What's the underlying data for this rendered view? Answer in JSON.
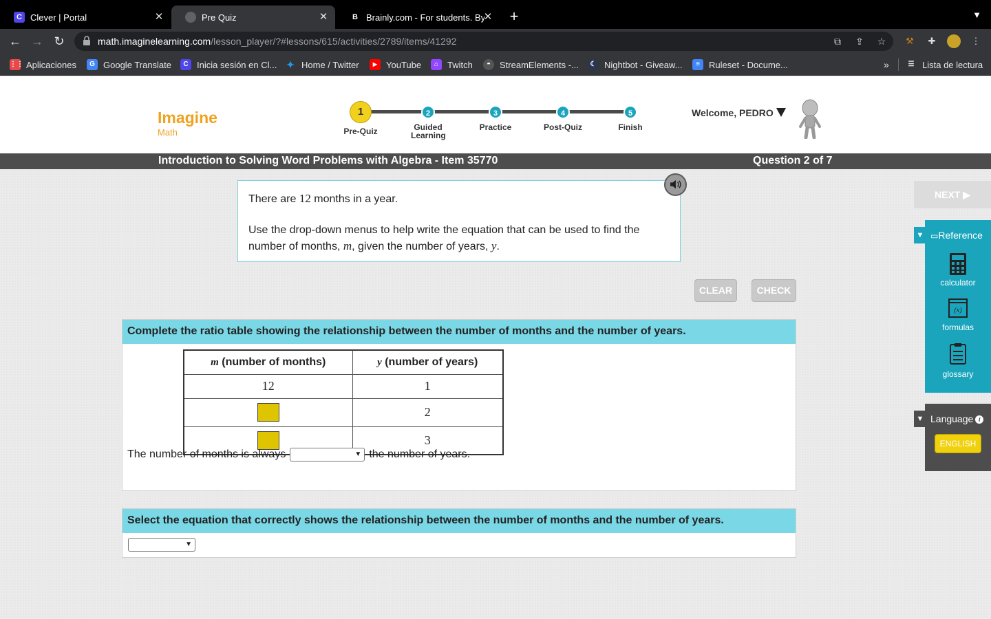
{
  "browser": {
    "tabs": [
      {
        "title": "Clever | Portal",
        "icon": "clever-icon",
        "color": "#4f45ea"
      },
      {
        "title": "Pre Quiz",
        "icon": "globe-icon",
        "active": true
      },
      {
        "title": "Brainly.com - For students. By",
        "icon": "brainly-icon"
      }
    ],
    "url_host": "math.imaginelearning.com",
    "url_path": "/lesson_player/?#lessons/615/activities/2789/items/41292",
    "bookmarks": [
      {
        "label": "Aplicaciones",
        "icon": "apps-grid-icon"
      },
      {
        "label": "Google Translate",
        "icon": "google-translate-icon"
      },
      {
        "label": "Inicia sesión en Cl...",
        "icon": "clever-icon"
      },
      {
        "label": "Home / Twitter",
        "icon": "twitter-icon"
      },
      {
        "label": "YouTube",
        "icon": "youtube-icon"
      },
      {
        "label": "Twitch",
        "icon": "twitch-icon"
      },
      {
        "label": "StreamElements -...",
        "icon": "streamelements-icon"
      },
      {
        "label": "Nightbot - Giveaw...",
        "icon": "nightbot-icon"
      },
      {
        "label": "Ruleset - Docume...",
        "icon": "google-docs-icon"
      }
    ],
    "reading_list": "Lista de lectura"
  },
  "app": {
    "logo_top": "Imagine",
    "logo_bottom": "Math",
    "steps": [
      {
        "num": "1",
        "label": "Pre-Quiz",
        "active": true
      },
      {
        "num": "2",
        "label": "Guided Learning"
      },
      {
        "num": "3",
        "label": "Practice"
      },
      {
        "num": "4",
        "label": "Post-Quiz"
      },
      {
        "num": "5",
        "label": "Finish"
      }
    ],
    "welcome": "Welcome, PEDRO",
    "lesson_title": "Introduction to Solving Word Problems with Algebra - Item 35770",
    "question_count": "Question 2 of 7"
  },
  "prompt": {
    "line1_pre": "There are ",
    "line1_num": "12",
    "line1_post": " months in a year.",
    "line2_a": "Use the drop-down menus to help write the equation that can be used to find the number of months, ",
    "var_m": "m",
    "line2_b": ", given the number of years, ",
    "var_y": "y",
    "line2_c": "."
  },
  "buttons": {
    "clear": "CLEAR",
    "check": "CHECK",
    "next": "NEXT ▶"
  },
  "part1": {
    "heading": "Complete the ratio table showing the relationship between the number of months and the number of years.",
    "col1_var": "m",
    "col1_label": " (number of months)",
    "col2_var": "y",
    "col2_label": " (number of years)",
    "rows": [
      {
        "m": "12",
        "y": "1"
      },
      {
        "m": "",
        "y": "2"
      },
      {
        "m": "",
        "y": "3"
      }
    ],
    "sentence_pre": "The number of months is always",
    "sentence_post": "the number of years.",
    "dropdown_value": ""
  },
  "part2": {
    "heading": "Select the equation that correctly shows the relationship between the number of months and the number of years.",
    "dropdown_value": ""
  },
  "sidebar": {
    "reference": "Reference",
    "tools": [
      "calculator",
      "formulas",
      "glossary"
    ],
    "language": "Language",
    "language_value": "ENGLISH"
  },
  "colors": {
    "accent": "#1aa5bd",
    "header_bar": "#7ad7e5",
    "logo": "#f0a21f",
    "active_step": "#f2d11c"
  }
}
